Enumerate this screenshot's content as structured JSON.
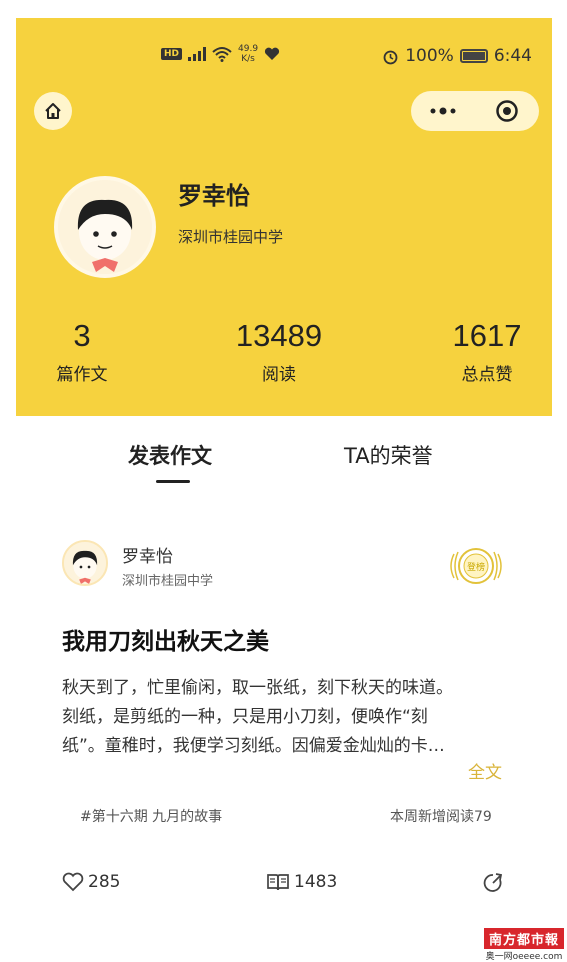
{
  "status_bar": {
    "network_badge": "HD",
    "speed_value": "49.9",
    "speed_unit": "K/s",
    "battery": "100%",
    "time": "6:44"
  },
  "profile": {
    "name": "罗幸怡",
    "school": "深圳市桂园中学"
  },
  "stats": [
    {
      "value": "3",
      "label": "篇作文"
    },
    {
      "value": "13489",
      "label": "阅读"
    },
    {
      "value": "1617",
      "label": "总点赞"
    }
  ],
  "tabs": [
    {
      "label": "发表作文",
      "active": true
    },
    {
      "label": "TA的荣誉",
      "active": false
    }
  ],
  "article": {
    "author": "罗幸怡",
    "school": "深圳市桂园中学",
    "badge": "登榜",
    "title": "我用刀刻出秋天之美",
    "excerpt_lines": [
      "秋天到了，忙里偷闲，取一张纸，刻下秋天的味道。",
      "刻纸，是剪纸的一种，只是用小刀刻，便唤作“刻",
      "纸”。童稚时，我便学习刻纸。因偏爱金灿灿的卡…"
    ],
    "full_text_link": "全文",
    "tag": "#第十六期 九月的故事",
    "weekly_reads": "本周新增阅读79",
    "likes": "285",
    "reads": "1483"
  },
  "watermark": {
    "main": "南方都市報",
    "sub": "奥一网oeeee.com"
  },
  "colors": {
    "header_bg": "#f6d23e",
    "accent_gold": "#d9b43a",
    "watermark_red": "#d8262c"
  },
  "icons": [
    "home-icon",
    "more-icon",
    "close-target-icon",
    "like-icon",
    "book-icon",
    "share-icon",
    "badge-icon"
  ]
}
